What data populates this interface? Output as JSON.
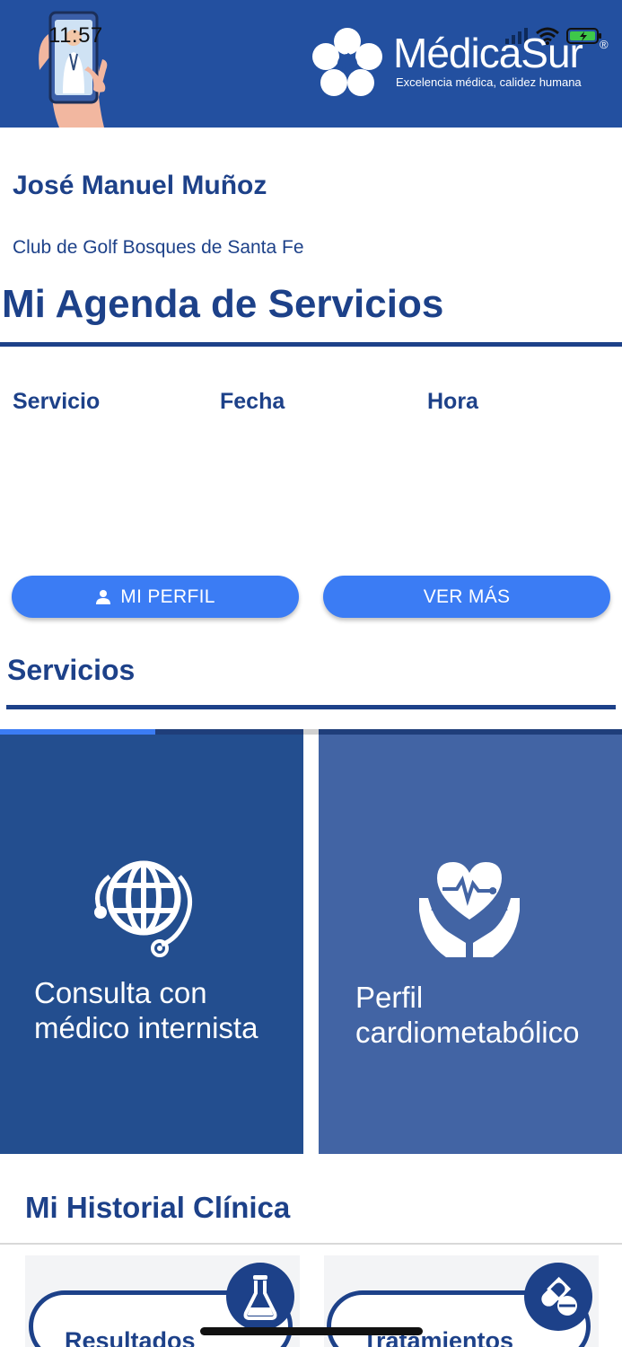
{
  "status_bar": {
    "time": "11:57"
  },
  "header": {
    "brand_name": "MédicaSur",
    "brand_registered": "®",
    "tagline": "Excelencia médica, calidez humana"
  },
  "user": {
    "name": "José Manuel Muñoz",
    "club": "Club de Golf Bosques de Santa Fe"
  },
  "agenda": {
    "title": "Mi Agenda de Servicios",
    "columns": [
      "Servicio",
      "Fecha",
      "Hora"
    ]
  },
  "actions": {
    "profile_label": "MI PERFIL",
    "more_label": "VER MÁS"
  },
  "services": {
    "title": "Servicios",
    "carousel_progress": 0.25,
    "cards": [
      {
        "line1": "Consulta con",
        "line2": "médico internista",
        "icon": "globe-stethoscope-icon"
      },
      {
        "line1": "Perfil",
        "line2": "cardiometabólico",
        "icon": "heart-hands-icon"
      }
    ]
  },
  "history": {
    "title": "Mi Historial Clínica",
    "items": [
      {
        "label": "Resultados",
        "icon": "flask-icon"
      },
      {
        "label": "Tratamientos",
        "icon": "pills-icon"
      }
    ]
  },
  "colors": {
    "primary": "#1d4189",
    "header_bg": "#2350a0",
    "button": "#3b7cf4",
    "card_left": "#234e8f",
    "card_right": "#4264a4"
  }
}
